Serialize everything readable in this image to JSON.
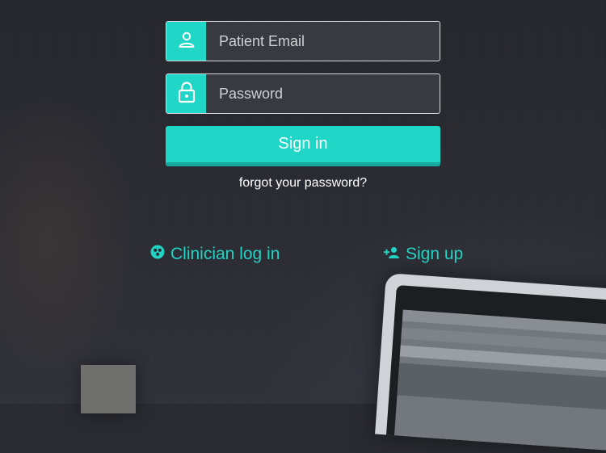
{
  "form": {
    "email_placeholder": "Patient Email",
    "password_placeholder": "Password",
    "signin_label": "Sign in",
    "forgot_label": "forgot your password?"
  },
  "links": {
    "clinician_label": "Clinician log in",
    "signup_label": "Sign up"
  },
  "icons": {
    "email": "user-icon",
    "password": "lock-icon",
    "clinician": "clinician-icon",
    "signup": "add-user-icon"
  },
  "colors": {
    "accent": "#20d6c6",
    "link": "#22d3c3",
    "background": "#2a2b31"
  }
}
